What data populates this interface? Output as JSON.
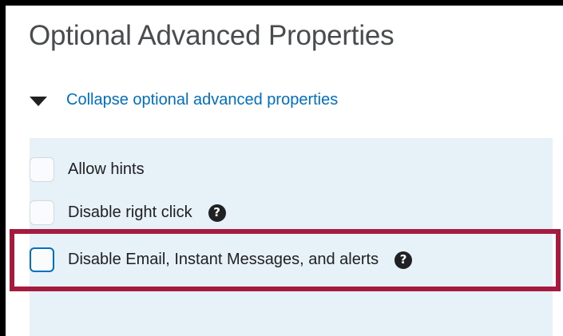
{
  "section": {
    "title": "Optional Advanced Properties",
    "collapse_link": "Collapse optional advanced properties"
  },
  "options": [
    {
      "label": "Allow hints",
      "checked": false,
      "has_help": false
    },
    {
      "label": "Disable right click",
      "checked": false,
      "has_help": true,
      "help_icon": "question-circle-icon"
    },
    {
      "label": "Disable Email, Instant Messages, and alerts",
      "checked": false,
      "has_help": true,
      "help_icon": "question-circle-icon",
      "highlighted": true
    }
  ],
  "colors": {
    "title_text": "#494c4e",
    "link": "#006fbf",
    "panel_background": "#e6f1f8",
    "highlight_border": "#a41b3f",
    "frame": "#000000"
  }
}
